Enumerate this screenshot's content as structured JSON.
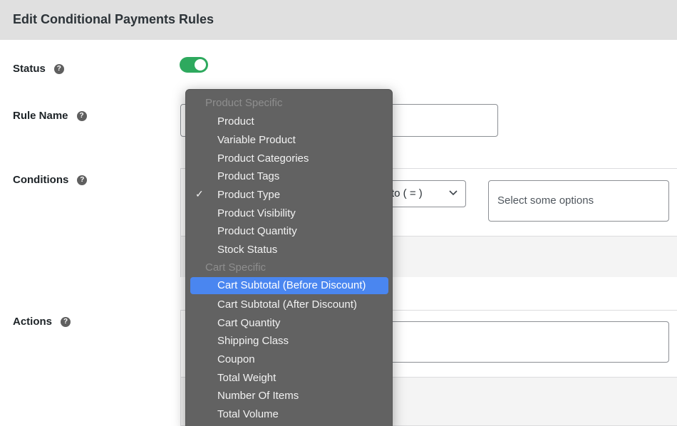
{
  "header": {
    "title": "Edit Conditional Payments Rules"
  },
  "fields": {
    "status": {
      "label": "Status",
      "enabled": true
    },
    "rule_name": {
      "label": "Rule Name",
      "value": ""
    },
    "conditions": {
      "label": "Conditions",
      "operator_value": "to ( = )",
      "options_placeholder": "Select some options"
    },
    "actions": {
      "label": "Actions",
      "value": ""
    }
  },
  "icons": {
    "help": "?",
    "check": "✓"
  },
  "colors": {
    "toggle_on": "#2ea95e",
    "highlight": "#4a86f0",
    "dropdown_bg": "#626262"
  },
  "dropdown": {
    "groups": [
      {
        "label": "Product Specific",
        "options": [
          {
            "label": "Product"
          },
          {
            "label": "Variable Product"
          },
          {
            "label": "Product Categories"
          },
          {
            "label": "Product Tags"
          },
          {
            "label": "Product Type",
            "checked": true
          },
          {
            "label": "Product Visibility"
          },
          {
            "label": "Product Quantity"
          },
          {
            "label": "Stock Status"
          }
        ]
      },
      {
        "label": "Cart Specific",
        "options": [
          {
            "label": "Cart Subtotal (Before Discount)",
            "highlighted": true
          },
          {
            "label": "Cart Subtotal (After Discount)"
          },
          {
            "label": "Cart Quantity"
          },
          {
            "label": "Shipping Class"
          },
          {
            "label": "Coupon"
          },
          {
            "label": "Total Weight"
          },
          {
            "label": "Number Of Items"
          },
          {
            "label": "Total Volume"
          }
        ]
      }
    ]
  }
}
